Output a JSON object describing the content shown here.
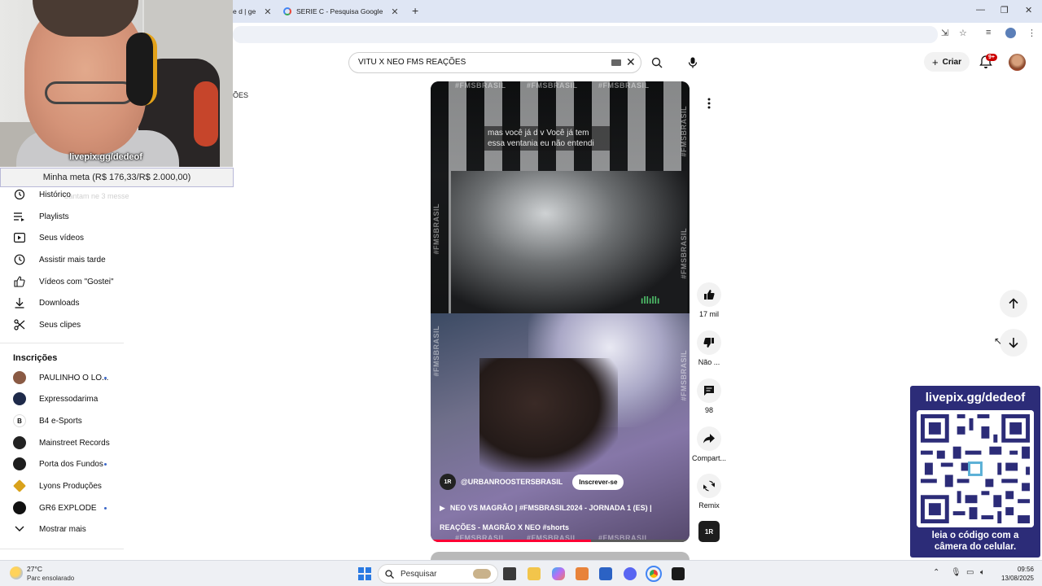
{
  "browser": {
    "tabs": [
      {
        "label": "e d | ge"
      },
      {
        "label": "SERIE C - Pesquisa Google"
      }
    ]
  },
  "header": {
    "search_query": "VITU X NEO FMS REAÇÕES",
    "create_label": "Criar",
    "notif_badge": "9+"
  },
  "overlay": {
    "stream_handle": "livepix.gg/dedeof",
    "goal_text": "Minha meta (R$ 176,33/R$ 2.000,00)",
    "ghost_top": "ÕES",
    "ghost_side": "Cantam ne 3 messe"
  },
  "sidebar": {
    "items": [
      {
        "label": "Histórico",
        "icon": "history-icon"
      },
      {
        "label": "Playlists",
        "icon": "playlists-icon"
      },
      {
        "label": "Seus vídeos",
        "icon": "your-videos-icon"
      },
      {
        "label": "Assistir mais tarde",
        "icon": "watch-later-icon"
      },
      {
        "label": "Vídeos com \"Gostei\"",
        "icon": "liked-videos-icon"
      },
      {
        "label": "Downloads",
        "icon": "download-icon"
      },
      {
        "label": "Seus clipes",
        "icon": "clips-icon"
      }
    ],
    "subs_title": "Inscrições",
    "subscriptions": [
      {
        "label": "PAULINHO O LO...",
        "color": "#8a5a44",
        "dot": true
      },
      {
        "label": "Expressodarima",
        "color": "#1e2a4a",
        "dot": false
      },
      {
        "label": "B4 e-Sports",
        "color": "#ffffff",
        "dot": false
      },
      {
        "label": "Mainstreet Records",
        "color": "#222222",
        "dot": false
      },
      {
        "label": "Porta dos Fundos",
        "color": "#1d1d1d",
        "dot": true
      },
      {
        "label": "Lyons Produções",
        "color": "#d9a21b",
        "dot": false
      },
      {
        "label": "GR6 EXPLODE",
        "color": "#111111",
        "dot": true
      }
    ],
    "show_more": "Mostrar mais"
  },
  "short": {
    "subtitle": "mas você já d v Você já tem essa ventania eu não entendi",
    "watermark": "#FMSBRASIL",
    "channel_logo": "1R",
    "channel_handle": "@URBANROOSTERSBRASIL",
    "subscribe_label": "Inscrever-se",
    "title_line1": "NEO VS MAGRÃO | #FMSBRASIL2024 - JORNADA 1 (ES) |",
    "title_line2": "REAÇÕES - MAGRÃO X NEO",
    "title_tag": "#shorts",
    "progress": 0.62
  },
  "actions": {
    "likes": "17 mil",
    "dislike": "Não ...",
    "comments": "98",
    "share": "Compart...",
    "remix": "Remix"
  },
  "qr": {
    "title": "livepix.gg/dedeof",
    "caption_line1": "leia o código com a",
    "caption_line2": "câmera do celular."
  },
  "taskbar": {
    "temp": "27°C",
    "weather": "Parc ensolarado",
    "search_placeholder": "Pesquisar",
    "time": "09:56",
    "date": "13/08/2025"
  },
  "colors": {
    "accent_red": "#ff0033",
    "qr_bg": "#2c2c78",
    "subscribe_dot": "#3b67c9"
  }
}
